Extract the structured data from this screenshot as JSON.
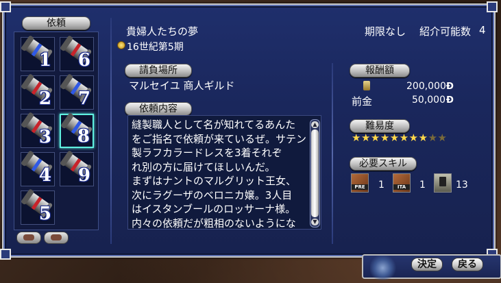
{
  "left_panel": {
    "title": "依頼",
    "slots": [
      {
        "num": "1",
        "tie": "blue"
      },
      {
        "num": "6",
        "tie": "red"
      },
      {
        "num": "2",
        "tie": "red"
      },
      {
        "num": "7",
        "tie": "blue"
      },
      {
        "num": "3",
        "tie": "red"
      },
      {
        "num": "8",
        "tie": "blue",
        "selected": true
      },
      {
        "num": "4",
        "tie": "blue"
      },
      {
        "num": "9",
        "tie": "red"
      },
      {
        "num": "5",
        "tie": "red"
      }
    ]
  },
  "quest": {
    "title": "貴婦人たちの夢",
    "deadline": "期限なし",
    "intro_label": "紹介可能数",
    "intro_count": "4",
    "era": "16世紀第5期"
  },
  "location": {
    "label": "請負場所",
    "value": "マルセイユ 商人ギルド"
  },
  "content": {
    "label": "依頼内容",
    "lines": [
      "縫製職人として名が知れてるあんた",
      "をご指名で依頼が来ているぜ。サテン",
      "製ラフカラードレスを3着それぞ",
      "れ別の方に届けてほしいんだ。",
      "まずはナントのマルグリット王女、",
      "次にラグーザのベロニカ嬢。3人目",
      "はイスタンブールのロッサーナ様。",
      "内々の依頼だが粗相のないようにな"
    ]
  },
  "reward": {
    "label": "報酬額",
    "amount": "200,000",
    "advance_label": "前金",
    "advance": "50,000",
    "currency": "Ð"
  },
  "difficulty": {
    "label": "難易度",
    "stars": "★★★★★★★★",
    "stars_off": "★★",
    "value": 8,
    "max": 10
  },
  "skills": {
    "label": "必要スキル",
    "items": [
      {
        "icon": "PRE",
        "level": "1"
      },
      {
        "icon": "ITA",
        "level": "1"
      },
      {
        "icon": "",
        "level": "13"
      }
    ]
  },
  "buttons": {
    "confirm": "決定",
    "back": "戻る"
  }
}
